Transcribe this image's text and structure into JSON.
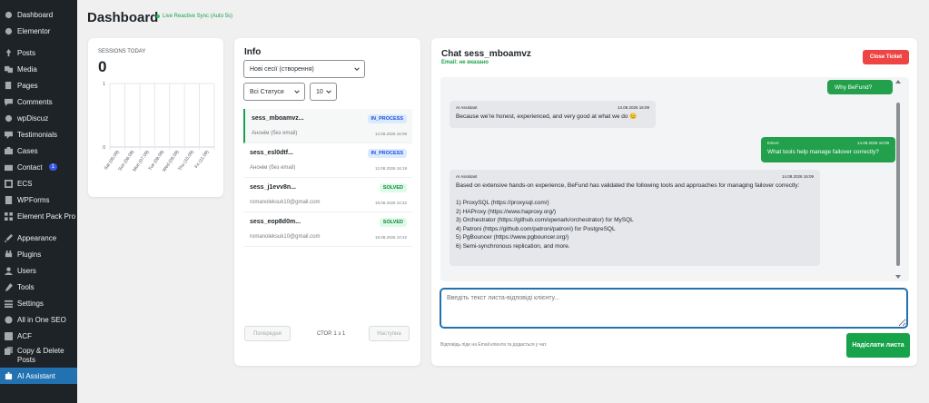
{
  "sidebar": {
    "items": [
      {
        "label": "Dashboard",
        "icon": "dashboard-icon"
      },
      {
        "label": "Elementor",
        "icon": "elementor-icon"
      },
      {
        "label": "Posts",
        "icon": "pin-icon"
      },
      {
        "label": "Media",
        "icon": "media-icon"
      },
      {
        "label": "Pages",
        "icon": "pages-icon"
      },
      {
        "label": "Comments",
        "icon": "comment-icon"
      },
      {
        "label": "wpDiscuz",
        "icon": "discuz-icon"
      },
      {
        "label": "Testimonials",
        "icon": "testimonial-icon"
      },
      {
        "label": "Cases",
        "icon": "cases-icon"
      },
      {
        "label": "Contact",
        "icon": "mail-icon",
        "badge": "1"
      },
      {
        "label": "ECS",
        "icon": "ecs-icon"
      },
      {
        "label": "WPForms",
        "icon": "forms-icon"
      },
      {
        "label": "Element Pack Pro",
        "icon": "grid-icon"
      },
      {
        "label": "Appearance",
        "icon": "brush-icon"
      },
      {
        "label": "Plugins",
        "icon": "plugin-icon"
      },
      {
        "label": "Users",
        "icon": "user-icon"
      },
      {
        "label": "Tools",
        "icon": "wrench-icon"
      },
      {
        "label": "Settings",
        "icon": "settings-icon"
      },
      {
        "label": "All in One SEO",
        "icon": "seo-icon"
      },
      {
        "label": "ACF",
        "icon": "acf-icon"
      },
      {
        "label": "Copy & Delete Posts",
        "icon": "copy-icon"
      },
      {
        "label": "AI Assistant",
        "icon": "robot-icon",
        "active": true
      }
    ]
  },
  "header": {
    "title": "Dashboard",
    "sync": "Live Reactive Sync (Auto 5s)"
  },
  "stats": {
    "label": "SESSIONS TODAY",
    "value": "0"
  },
  "chart_data": {
    "type": "bar",
    "categories": [
      "Sat (05.09)",
      "Sun (06.09)",
      "Mon (07.09)",
      "Tue (08.09)",
      "Wed (09.09)",
      "Thu (10.09)",
      "Fri (11.09)"
    ],
    "values": [
      0,
      0,
      0,
      0,
      0,
      0,
      0
    ],
    "ylim": [
      0,
      1
    ],
    "yticks": [
      "0",
      "1"
    ],
    "grid": true
  },
  "info": {
    "title": "Info",
    "filter_new": "Нові сесії (створення)",
    "filter_status": "Всі Статуси",
    "filter_count": "10",
    "sessions": [
      {
        "name": "sess_mboamvz...",
        "user": "Анонім (без email)",
        "status": "IN_PROCESS",
        "time": "14.08.2026 16:09"
      },
      {
        "name": "sess_esl0dtf...",
        "user": "Анонім (без email)",
        "status": "IN_PROCESS",
        "time": "12.08.2026 16:19"
      },
      {
        "name": "sess_j1evv8n...",
        "user": "romanoleksuk10@gmail.com",
        "status": "SOLVED",
        "time": "19.08.2026 10:32"
      },
      {
        "name": "sess_eop8d0m...",
        "user": "romanoleksuk10@gmail.com",
        "status": "SOLVED",
        "time": "19.08.2026 10:32"
      }
    ],
    "pager": {
      "prev": "Попередня",
      "page": "СТОР. 1 з 1",
      "next": "Наступна"
    }
  },
  "chat": {
    "title": "Chat sess_mboamvz",
    "email": "Email: не вказано",
    "close": "Close Ticket",
    "messages": [
      {
        "role": "client",
        "sender": "",
        "time": "",
        "text": "Why BeFund?"
      },
      {
        "role": "assistant",
        "sender": "AI Assistant",
        "time": "14.08.2026 16:09",
        "text": "Because we're honest, experienced, and very good at what we do 😊"
      },
      {
        "role": "client",
        "sender": "Клієнт",
        "time": "14.08.2026 16:09",
        "text": "What tools help manage failover correctly?"
      },
      {
        "role": "assistant",
        "sender": "AI Assistant",
        "time": "14.08.2026 16:09",
        "text": "Based on extensive hands-on experience, BeFund has validated the following tools and approaches for managing failover correctly:\n\n1) ProxySQL (https://proxysql.com/)\n2) HAProxy (https://www.haproxy.org/)\n3) Orchestrator (https://github.com/openark/orchestrator) for MySQL\n4) Patroni (https://github.com/patroni/patroni) for PostgreSQL\n5) PgBouncer (https://www.pgbouncer.org/)\n6) Semi-synchronous replication, and more."
      }
    ],
    "reply_placeholder": "Введіть текст листа-відповіді клієнту...",
    "note": "Відповідь піде на Email клієнта та додасться у чат.",
    "send": "Надіслати листа"
  },
  "colors": {
    "sidebar_bg": "#1d2327",
    "active": "#2271b1",
    "green": "#16a34a",
    "danger": "#ef4444"
  }
}
